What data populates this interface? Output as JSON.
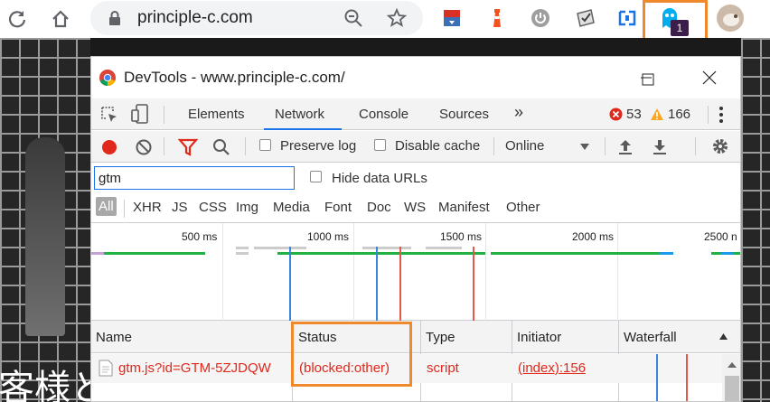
{
  "browser": {
    "url": "principle-c.com",
    "extension_badge": "1"
  },
  "background_page": {
    "text": "客様と"
  },
  "devtools": {
    "title": "DevTools - www.principle-c.com/",
    "tabs": [
      "Elements",
      "Network",
      "Console",
      "Sources"
    ],
    "active_tab": "Network",
    "more_tabs": "»",
    "errors": "53",
    "warnings": "166",
    "network_toolbar": {
      "preserve_log": "Preserve log",
      "disable_cache": "Disable cache",
      "throttling": "Online"
    },
    "filter": {
      "value": "gtm",
      "hide_data_urls": "Hide data URLs"
    },
    "types": [
      "All",
      "XHR",
      "JS",
      "CSS",
      "Img",
      "Media",
      "Font",
      "Doc",
      "WS",
      "Manifest",
      "Other"
    ],
    "active_type": "All",
    "timeline_ticks": [
      "500 ms",
      "1000 ms",
      "1500 ms",
      "2000 ms",
      "2500 n"
    ],
    "columns": [
      "Name",
      "Status",
      "Type",
      "Initiator",
      "Waterfall"
    ],
    "requests": [
      {
        "name": "gtm.js?id=GTM-5ZJDQW",
        "status": "(blocked:other)",
        "type": "script",
        "initiator": "(index):156"
      }
    ]
  },
  "colors": {
    "highlight": "#f0882c",
    "error_red": "#e0281c",
    "accent_blue": "#1a73e8",
    "badge_bg": "#3c1e4b"
  }
}
